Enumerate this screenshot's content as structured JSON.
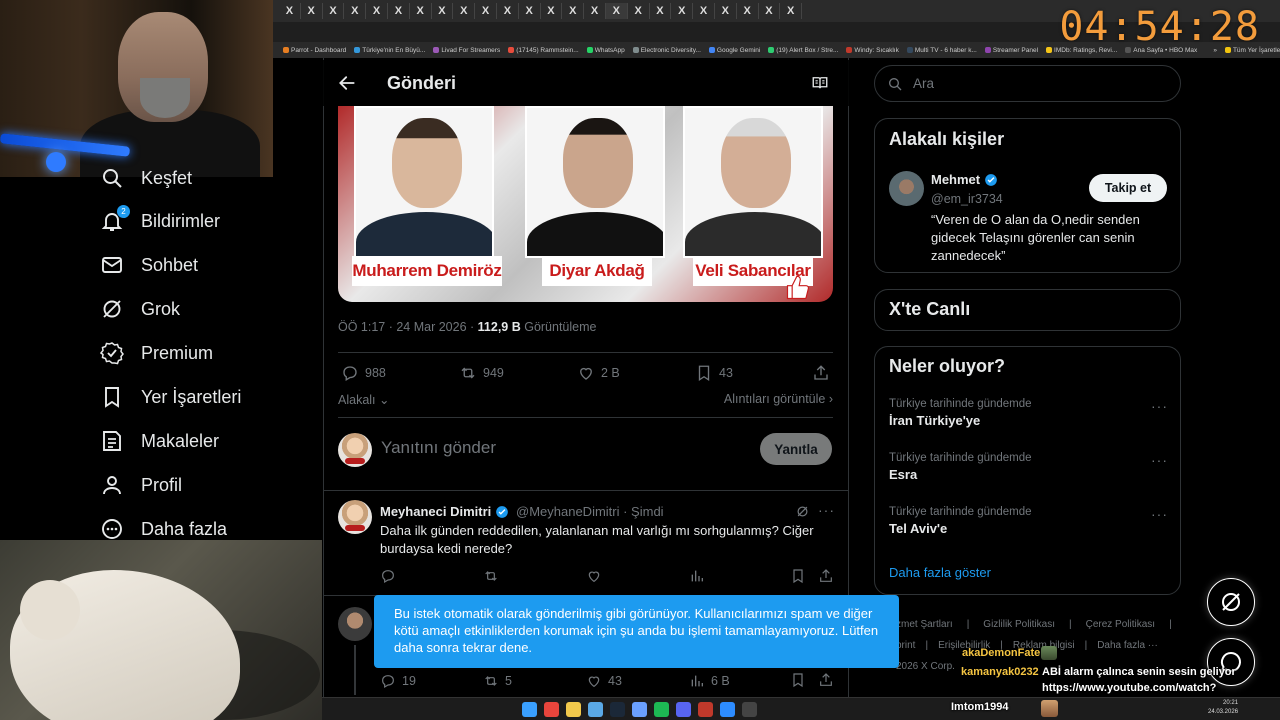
{
  "overlay": {
    "clock": "04:54:28"
  },
  "browser": {
    "tab_label": "X",
    "bookmarks": [
      {
        "label": "Parrot - Dashboard",
        "color": "#e67e22"
      },
      {
        "label": "Türkiye'nin En Büyü...",
        "color": "#3498db"
      },
      {
        "label": "Livad For Streamers",
        "color": "#9b59b6"
      },
      {
        "label": "(17145) Rammstein...",
        "color": "#e74c3c"
      },
      {
        "label": "WhatsApp",
        "color": "#25d366"
      },
      {
        "label": "Electronic Diversity...",
        "color": "#7f8c8d"
      },
      {
        "label": "Google Gemini",
        "color": "#4285f4"
      },
      {
        "label": "(19) Alert Box / Stre...",
        "color": "#2ecc71"
      },
      {
        "label": "Windy: Sıcaklık",
        "color": "#c0392b"
      },
      {
        "label": "Multi TV - 6 haber k...",
        "color": "#34495e"
      },
      {
        "label": "Streamer Panel",
        "color": "#8e44ad"
      },
      {
        "label": "IMDb: Ratings, Revi...",
        "color": "#f5c518"
      },
      {
        "label": "Ana Sayfa • HBO Max",
        "color": "#555555"
      },
      {
        "label": "»",
        "color": "transparent"
      },
      {
        "label": "Tüm Yer İşaretleri",
        "color": "#f1c40f"
      }
    ]
  },
  "nav": {
    "items": [
      {
        "label": "Keşfet",
        "icon": "search-icon"
      },
      {
        "label": "Bildirimler",
        "icon": "bell-icon",
        "badge": "2"
      },
      {
        "label": "Sohbet",
        "icon": "mail-icon"
      },
      {
        "label": "Grok",
        "icon": "grok-icon"
      },
      {
        "label": "Premium",
        "icon": "verified-icon"
      },
      {
        "label": "Yer İşaretleri",
        "icon": "bookmark-icon"
      },
      {
        "label": "Makaleler",
        "icon": "article-icon"
      },
      {
        "label": "Profil",
        "icon": "person-icon"
      },
      {
        "label": "Daha fazla",
        "icon": "more-circle-icon"
      }
    ]
  },
  "post": {
    "header_title": "Gönderi",
    "photo_captions": [
      "Muharrem Demiröz",
      "Diyar Akdağ",
      "Veli Sabancılar"
    ],
    "time": "ÖÖ 1:17 · 24 Mar 2026 · ",
    "views_count": "112,9 B",
    "views_label": " Görüntüleme",
    "stats": {
      "replies": "988",
      "reposts": "949",
      "likes": "2 B",
      "bookmarks": "43"
    },
    "related_label": "Alakalı",
    "quotes_label": "Alıntıları görüntüle",
    "reply_placeholder": "Yanıtını gönder",
    "reply_button": "Yanıtla"
  },
  "reply_tweet": {
    "name": "Meyhaneci Dimitri",
    "handle_time": "@MeyhaneDimitri · Şimdi",
    "text": "Daha ilk günden reddedilen, yalanlanan mal varlığı mı sorhgulanmış? Ciğer burdaysa kedi nerede?"
  },
  "next_tweet_stats": {
    "replies": "19",
    "reposts": "5",
    "likes": "43",
    "views": "6 B"
  },
  "toast": {
    "text": "Bu istek otomatik olarak gönderilmiş gibi görünüyor. Kullanıcılarımızı spam ve diğer kötü amaçlı etkinliklerden korumak için şu anda bu işlemi tamamlayamıyoruz. Lütfen daha sonra tekrar dene."
  },
  "sidebar": {
    "search_placeholder": "Ara",
    "related_people": {
      "title": "Alakalı kişiler",
      "name": "Mehmet",
      "handle": "@em_ir3734",
      "bio": "“Veren de O alan da O,nedir senden gidecek Telaşını görenler can senin zannedecek”",
      "follow_label": "Takip et"
    },
    "live_title": "X'te Canlı",
    "trends": {
      "title": "Neler oluyor?",
      "items": [
        {
          "context": "Türkiye tarihinde gündemde",
          "name": "İran Türkiye'ye"
        },
        {
          "context": "Türkiye tarihinde gündemde",
          "name": "Esra"
        },
        {
          "context": "Türkiye tarihinde gündemde",
          "name": "Tel Aviv'e"
        }
      ],
      "more_label": "Daha fazla göster",
      "dots": "···"
    },
    "footer_line1": [
      "zmet Şartları",
      "Gizlilik Politikası",
      "Çerez Politikası"
    ],
    "footer_line2": [
      "print",
      "Erişilebilirlik",
      "Reklam bilgisi",
      "Daha fazla ···"
    ],
    "footer_line3": "2026 X Corp."
  },
  "chat": {
    "messages": [
      {
        "user": "akaDemonFate",
        "text": ""
      },
      {
        "user": "kamanyak0232",
        "text": "ABİ alarm çalınca senin sesin geliyor"
      },
      {
        "user": "",
        "text": "https://www.youtube.com/watch?"
      },
      {
        "user": "Imtom1994",
        "text": ""
      }
    ]
  },
  "taskbar": {
    "time": "20:21",
    "date": "24.03.2026"
  }
}
